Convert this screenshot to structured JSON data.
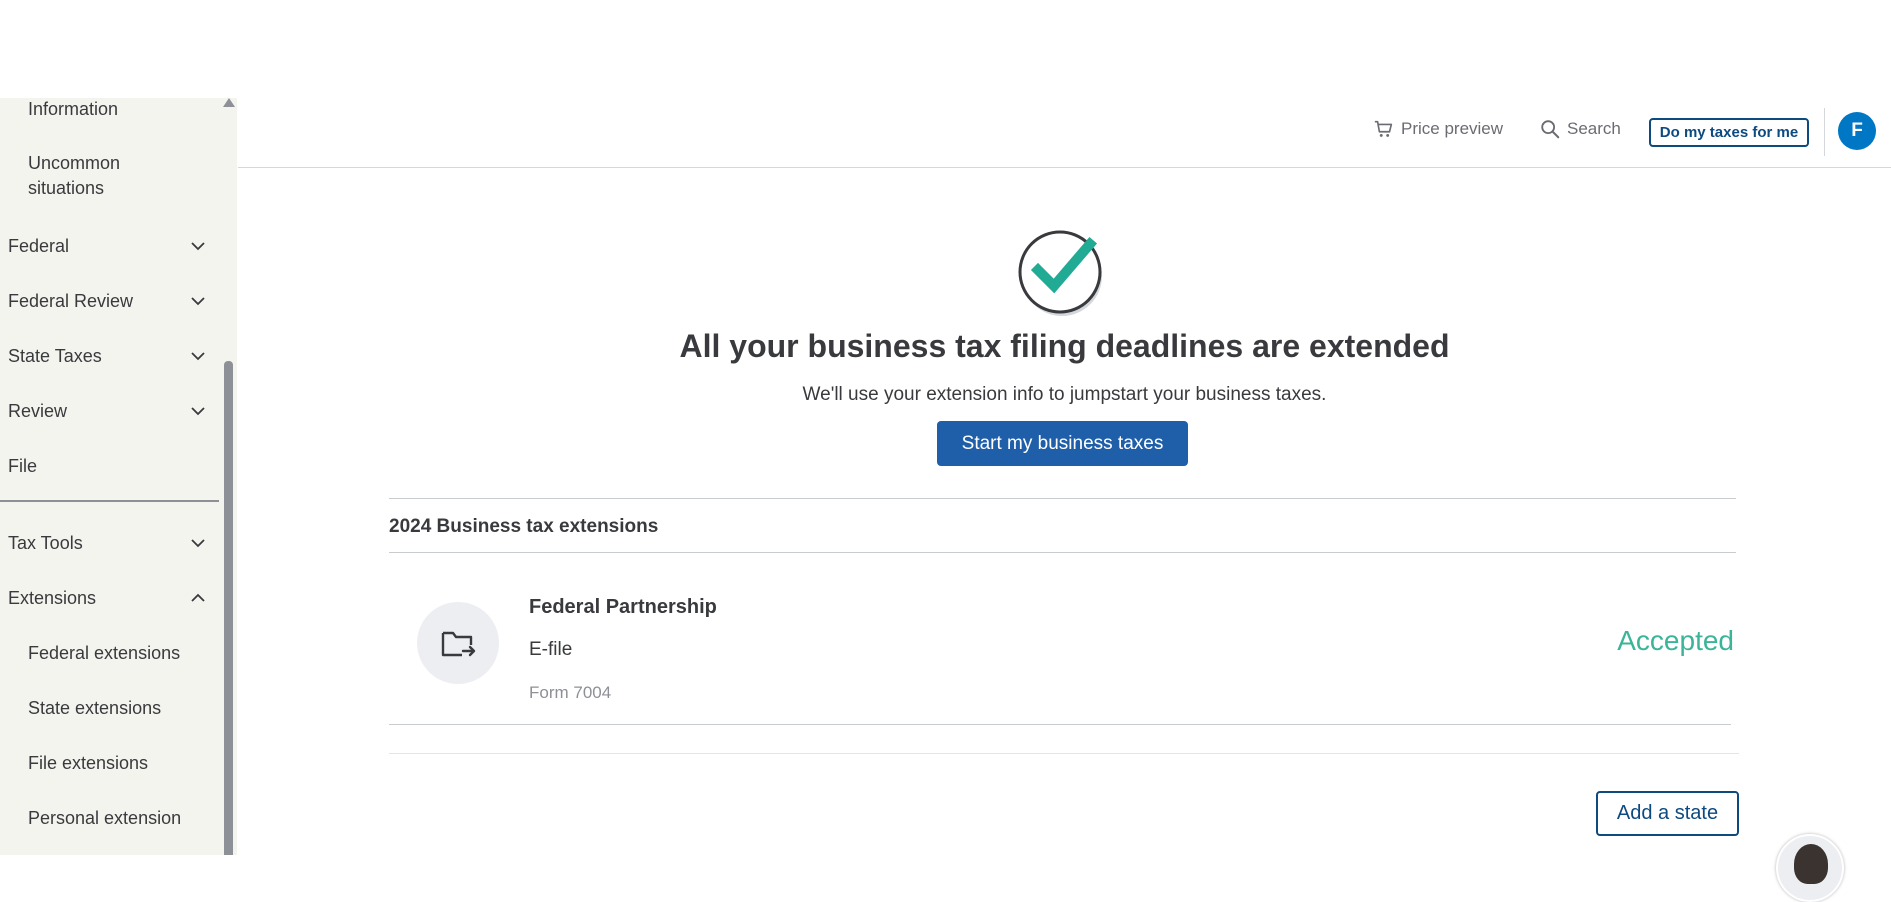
{
  "sidebar": {
    "items": [
      {
        "label": "Information"
      },
      {
        "label": "Uncommon situations"
      },
      {
        "label": "Federal"
      },
      {
        "label": "Federal Review"
      },
      {
        "label": "State Taxes"
      },
      {
        "label": "Review"
      },
      {
        "label": "File"
      },
      {
        "label": "Tax Tools"
      },
      {
        "label": "Extensions"
      },
      {
        "label": "Federal extensions"
      },
      {
        "label": "State extensions"
      },
      {
        "label": "File extensions"
      },
      {
        "label": "Personal extension"
      }
    ]
  },
  "header": {
    "price_preview": "Price preview",
    "search": "Search",
    "do_my_taxes": "Do my taxes for me",
    "avatar_initial": "F"
  },
  "main": {
    "headline": "All your business tax filing deadlines are extended",
    "subline": "We'll use your extension info to jumpstart your business taxes.",
    "primary_button": "Start my business taxes",
    "section_title": "2024 Business tax extensions",
    "extension_row": {
      "title": "Federal Partnership",
      "method": "E-file",
      "form": "Form 7004",
      "status": "Accepted"
    },
    "add_state_button": "Add a state"
  },
  "colors": {
    "primary": "#1f5ea8",
    "accent_dark": "#0d4a80",
    "status_accepted": "#3bb49a",
    "check_green": "#21ab94",
    "avatar_blue": "#0077c5"
  },
  "icons": {
    "cart": "cart-icon",
    "search": "search-icon",
    "check": "checkmark-badge-icon",
    "folder": "folder-export-icon",
    "chevron_down": "chevron-down-icon",
    "chevron_up": "chevron-up-icon"
  }
}
